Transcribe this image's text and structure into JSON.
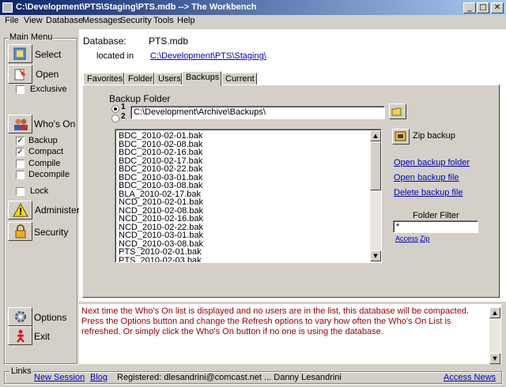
{
  "window": {
    "title": "C:\\Development\\PTS\\Staging\\PTS.mdb --> The Workbench",
    "minimize_glyph": "_",
    "maximize_glyph": "□",
    "close_glyph": "✕"
  },
  "menubar": {
    "items": [
      "File",
      "View",
      "Database",
      "Messages",
      "Security",
      "Tools",
      "Help"
    ]
  },
  "main_menu": {
    "title": "Main Menu",
    "select_label": "Select",
    "open_label": "Open",
    "exclusive_label": "Exclusive",
    "exclusive_checked": false,
    "whos_on_label": "Who's On",
    "backup_label": "Backup",
    "backup_checked": true,
    "compact_label": "Compact",
    "compact_checked": true,
    "compile_label": "Compile",
    "compile_checked": false,
    "decompile_label": "Decompile",
    "decompile_checked": false,
    "lock_label": "Lock",
    "lock_checked": false,
    "administer_label": "Administer",
    "security_label": "Security",
    "options_label": "Options",
    "exit_label": "Exit",
    "check_glyph": "✓"
  },
  "database": {
    "label": "Database:",
    "name": "PTS.mdb",
    "located_label": "located in",
    "location": "C:\\Development\\PTS\\Staging\\"
  },
  "tabs": [
    "Favorites",
    "Folder",
    "Users",
    "Backups",
    "Current"
  ],
  "active_tab": "Backups",
  "backups": {
    "folder_label": "Backup Folder",
    "radio1_label": "1",
    "radio2_label": "2",
    "selected_radio": 1,
    "folder_path": "C:\\Development\\Archive\\Backups\\",
    "zip_label": "Zip backup",
    "files": [
      "BDC_2010-02-01.bak",
      "BDC_2010-02-08.bak",
      "BDC_2010-02-16.bak",
      "BDC_2010-02-17.bak",
      "BDC_2010-02-22.bak",
      "BDC_2010-03-01.bak",
      "BDC_2010-03-08.bak",
      "BLA_2010-02-17.bak",
      "NCD_2010-02-01.bak",
      "NCD_2010-02-08.bak",
      "NCD_2010-02-16.bak",
      "NCD_2010-02-22.bak",
      "NCD_2010-03-01.bak",
      "NCD_2010-03-08.bak",
      "PTS_2010-02-01.bak",
      "PTS_2010-02-03.bak"
    ],
    "open_folder_link": "Open backup folder",
    "open_file_link": "Open backup file",
    "delete_file_link": "Delete backup file",
    "filter_label": "Folder Filter",
    "filter_value": "*",
    "access_link": "Access",
    "zip_link": "Zip",
    "scroll_up_glyph": "▲",
    "scroll_down_glyph": "▼"
  },
  "message": {
    "text": "Next time the Who's On list is displayed and no users are in the list, this database will be compacted.  Press the Options button and change the Refresh options to vary how often the Who's On List is refreshed. Or simply click the Who's On button if no one is using the database."
  },
  "links_bar": {
    "title": "Links",
    "new_session": "New Session",
    "blog": "Blog",
    "registered": "Registered:  dlesandrini@comcast.net  ...  Danny Lesandrini",
    "access_news": "Access News"
  }
}
